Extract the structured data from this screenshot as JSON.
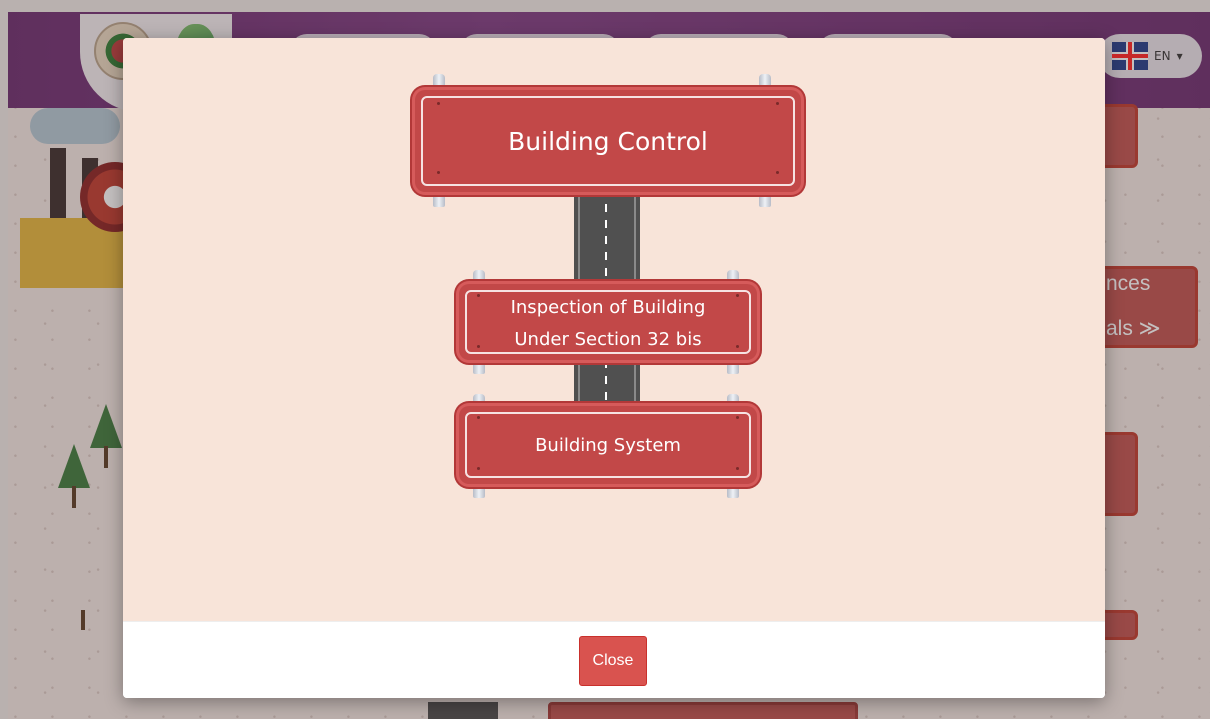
{
  "background": {
    "language": {
      "code": "EN",
      "caret": "▾"
    },
    "side_signs": [
      {
        "text": "nces"
      },
      {
        "text": "als ≫"
      }
    ]
  },
  "modal": {
    "signs": {
      "main": {
        "label": "Building Control"
      },
      "inspection": {
        "line1": "Inspection of Building",
        "line2": "Under Section 32 bis"
      },
      "system": {
        "label": "Building System"
      }
    },
    "footer": {
      "close_label": "Close"
    }
  },
  "colors": {
    "sign_red": "#c24848",
    "modal_body_bg": "#f8e4d9",
    "close_button_bg": "#d9534f",
    "topbar_purple": "#6b2a6e"
  },
  "icons": [
    "uk-flag-icon",
    "chevron-down-icon",
    "factory-illustration",
    "tree-icon",
    "road-illustration"
  ]
}
